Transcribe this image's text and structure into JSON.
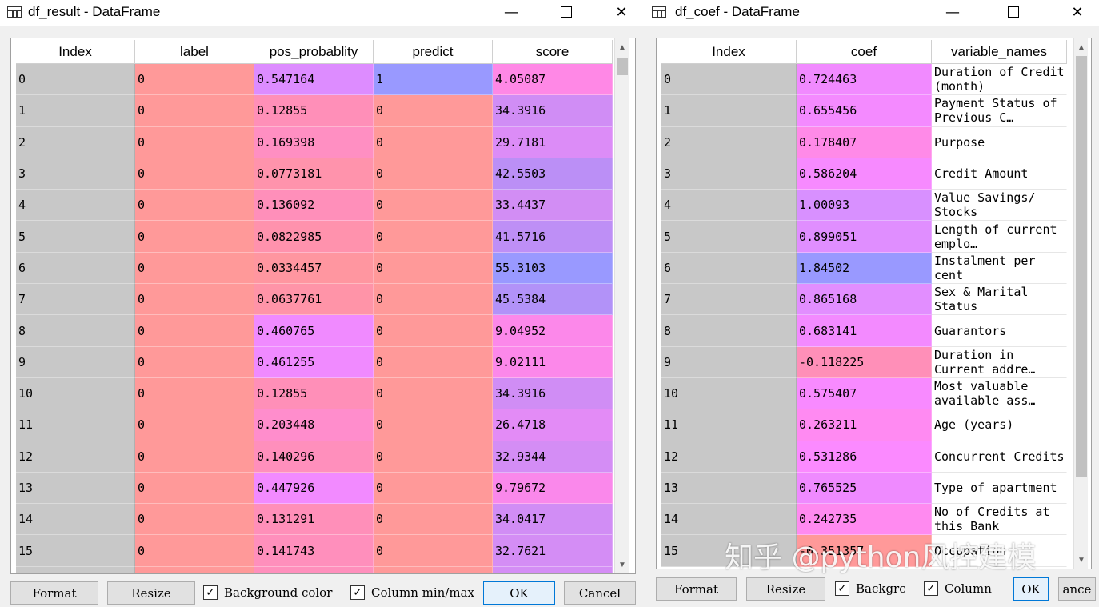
{
  "left_window": {
    "title": "df_result - DataFrame",
    "controls": {
      "minimize": "—",
      "close": "✕"
    },
    "columns": [
      "Index",
      "label",
      "pos_probablity",
      "predict",
      "score"
    ],
    "rows": [
      {
        "index": "0",
        "label": "0",
        "pos_probablity": "0.547164",
        "predict": "1",
        "score": "4.05087",
        "colors": [
          "#ff9999",
          "#dd8cff",
          "#9999ff",
          "#ff88e6"
        ]
      },
      {
        "index": "1",
        "label": "0",
        "pos_probablity": "0.12855",
        "predict": "0",
        "score": "34.3916",
        "colors": [
          "#ff9999",
          "#ff8fb8",
          "#ff9999",
          "#d08df5"
        ]
      },
      {
        "index": "2",
        "label": "0",
        "pos_probablity": "0.169398",
        "predict": "0",
        "score": "29.7181",
        "colors": [
          "#ff9999",
          "#ff8fc2",
          "#ff9999",
          "#dc8cf7"
        ]
      },
      {
        "index": "3",
        "label": "0",
        "pos_probablity": "0.0773181",
        "predict": "0",
        "score": "42.5503",
        "colors": [
          "#ff9999",
          "#ff93ac",
          "#ff9999",
          "#bb8ff6"
        ]
      },
      {
        "index": "4",
        "label": "0",
        "pos_probablity": "0.136092",
        "predict": "0",
        "score": "33.4437",
        "colors": [
          "#ff9999",
          "#ff8fba",
          "#ff9999",
          "#d28df4"
        ]
      },
      {
        "index": "5",
        "label": "0",
        "pos_probablity": "0.0822985",
        "predict": "0",
        "score": "41.5716",
        "colors": [
          "#ff9999",
          "#ff92ad",
          "#ff9999",
          "#be8ff6"
        ]
      },
      {
        "index": "6",
        "label": "0",
        "pos_probablity": "0.0334457",
        "predict": "0",
        "score": "55.3103",
        "colors": [
          "#ff9999",
          "#ff96a0",
          "#ff9999",
          "#9999ff"
        ]
      },
      {
        "index": "7",
        "label": "0",
        "pos_probablity": "0.0637761",
        "predict": "0",
        "score": "45.5384",
        "colors": [
          "#ff9999",
          "#ff94a8",
          "#ff9999",
          "#b292f8"
        ]
      },
      {
        "index": "8",
        "label": "0",
        "pos_probablity": "0.460765",
        "predict": "0",
        "score": "9.04952",
        "colors": [
          "#ff9999",
          "#f08aff",
          "#ff9999",
          "#fc88ea"
        ]
      },
      {
        "index": "9",
        "label": "0",
        "pos_probablity": "0.461255",
        "predict": "0",
        "score": "9.02111",
        "colors": [
          "#ff9999",
          "#f08aff",
          "#ff9999",
          "#fc88ea"
        ]
      },
      {
        "index": "10",
        "label": "0",
        "pos_probablity": "0.12855",
        "predict": "0",
        "score": "34.3916",
        "colors": [
          "#ff9999",
          "#ff8fb8",
          "#ff9999",
          "#d08df5"
        ]
      },
      {
        "index": "11",
        "label": "0",
        "pos_probablity": "0.203448",
        "predict": "0",
        "score": "26.4718",
        "colors": [
          "#ff9999",
          "#ff8dcc",
          "#ff9999",
          "#e38bf6"
        ]
      },
      {
        "index": "12",
        "label": "0",
        "pos_probablity": "0.140296",
        "predict": "0",
        "score": "32.9344",
        "colors": [
          "#ff9999",
          "#ff8fbc",
          "#ff9999",
          "#d48df5"
        ]
      },
      {
        "index": "13",
        "label": "0",
        "pos_probablity": "0.447926",
        "predict": "0",
        "score": "9.79672",
        "colors": [
          "#ff9999",
          "#f28aff",
          "#ff9999",
          "#fa88eb"
        ]
      },
      {
        "index": "14",
        "label": "0",
        "pos_probablity": "0.131291",
        "predict": "0",
        "score": "34.0417",
        "colors": [
          "#ff9999",
          "#ff8fb9",
          "#ff9999",
          "#d18df5"
        ]
      },
      {
        "index": "15",
        "label": "0",
        "pos_probablity": "0.141743",
        "predict": "0",
        "score": "32.7621",
        "colors": [
          "#ff9999",
          "#ff8fbc",
          "#ff9999",
          "#d48df5"
        ]
      },
      {
        "index": "",
        "label": "",
        "pos_probablity": "",
        "predict": "",
        "score": "",
        "colors": [
          "#ff9999",
          "#ff8fbc",
          "#ff9999",
          "#d48df5"
        ]
      }
    ],
    "buttons": {
      "format": "Format",
      "resize": "Resize",
      "ok": "OK",
      "cancel": "Cancel"
    },
    "checkboxes": {
      "background_color": "Background color",
      "column_minmax": "Column min/max",
      "check_mark": "✓"
    },
    "scroll": {
      "up": "▲",
      "down": "▼"
    }
  },
  "right_window": {
    "title": "df_coef - DataFrame",
    "controls": {
      "minimize": "—",
      "close": "✕"
    },
    "columns": [
      "Index",
      "coef",
      "variable_names"
    ],
    "rows": [
      {
        "index": "0",
        "coef": "0.724463",
        "variable_name": "Duration of Credit (month)",
        "color": "#f18aff"
      },
      {
        "index": "1",
        "coef": "0.655456",
        "variable_name": "Payment Status of Previous C…",
        "color": "#f48aff"
      },
      {
        "index": "2",
        "coef": "0.178407",
        "variable_name": "Purpose",
        "color": "#ff8ae8"
      },
      {
        "index": "3",
        "coef": "0.586204",
        "variable_name": "Credit Amount",
        "color": "#f78aff"
      },
      {
        "index": "4",
        "coef": "1.00093",
        "variable_name": "Value Savings/ Stocks",
        "color": "#d890ff"
      },
      {
        "index": "5",
        "coef": "0.899051",
        "variable_name": "Length of current emplo…",
        "color": "#e08eff"
      },
      {
        "index": "6",
        "coef": "1.84502",
        "variable_name": "Instalment per cent",
        "color": "#9999ff"
      },
      {
        "index": "7",
        "coef": "0.865168",
        "variable_name": "Sex & Marital Status",
        "color": "#e28eff"
      },
      {
        "index": "8",
        "coef": "0.683141",
        "variable_name": "Guarantors",
        "color": "#f38aff"
      },
      {
        "index": "9",
        "coef": "-0.118225",
        "variable_name": "Duration in Current addre…",
        "color": "#ff8fb8"
      },
      {
        "index": "10",
        "coef": "0.575407",
        "variable_name": "Most valuable available ass…",
        "color": "#f88aff"
      },
      {
        "index": "11",
        "coef": "0.263211",
        "variable_name": "Age (years)",
        "color": "#ff8af2"
      },
      {
        "index": "12",
        "coef": "0.531286",
        "variable_name": "Concurrent Credits",
        "color": "#fb8aff"
      },
      {
        "index": "13",
        "coef": "0.765525",
        "variable_name": "Type of apartment",
        "color": "#ef8aff"
      },
      {
        "index": "14",
        "coef": "0.242735",
        "variable_name": "No of Credits at this Bank",
        "color": "#ff8af0"
      },
      {
        "index": "15",
        "coef": "-0.351357",
        "variable_name": "Occupation",
        "color": "#ff9999"
      }
    ],
    "buttons": {
      "format": "Format",
      "resize": "Resize",
      "ok": "OK",
      "cancel": "ance"
    },
    "checkboxes": {
      "background_color": "Backgrc",
      "column_minmax": "Column",
      "check_mark": "✓"
    },
    "scroll": {
      "up": "▲",
      "down": "▼"
    }
  },
  "watermark": "知乎 @python风控建模"
}
